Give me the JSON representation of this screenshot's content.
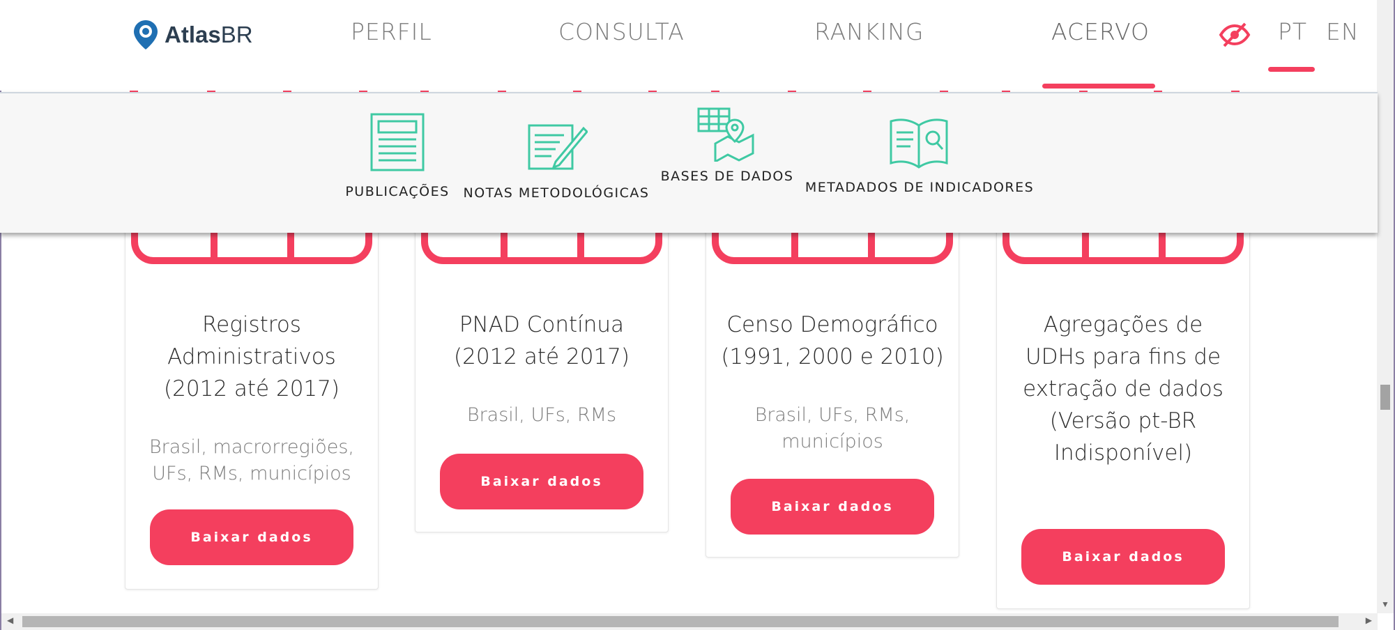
{
  "brand": {
    "name_bold": "Atlas",
    "name_regular": "BR"
  },
  "nav": {
    "links": [
      "PERFIL",
      "CONSULTA",
      "RANKING",
      "ACERVO"
    ],
    "active": "ACERVO",
    "languages": [
      "PT",
      "EN"
    ],
    "active_language": "PT"
  },
  "dropdown": {
    "items": [
      {
        "label": "PUBLICAÇÕES",
        "icon": "document-icon"
      },
      {
        "label": "NOTAS METODOLÓGICAS",
        "icon": "notes-pencil-icon"
      },
      {
        "label": "BASES DE DADOS",
        "icon": "grid-map-pin-icon"
      },
      {
        "label": "METADADOS DE INDICADORES",
        "icon": "open-book-search-icon"
      }
    ]
  },
  "cards": [
    {
      "title_lines": [
        "Registros",
        "Administrativos",
        "(2012 até 2017)"
      ],
      "sub_lines": [
        "Brasil, macrorregiões,",
        "UFs, RMs, municípios"
      ],
      "button": "Baixar dados"
    },
    {
      "title_lines": [
        "PNAD Contínua",
        "(2012 até 2017)"
      ],
      "sub_lines": [
        "Brasil, UFs, RMs"
      ],
      "button": "Baixar dados"
    },
    {
      "title_lines": [
        "Censo Demográfico",
        "(1991, 2000 e 2010)"
      ],
      "sub_lines": [
        "Brasil, UFs, RMs,",
        "municípios"
      ],
      "button": "Baixar dados"
    },
    {
      "title_lines": [
        "Agregações de",
        "UDHs para fins de",
        "extração de dados",
        "(Versão pt-BR",
        "Indisponível)"
      ],
      "sub_lines": [],
      "button": "Baixar dados"
    }
  ],
  "colors": {
    "accent": "#f43f5e",
    "teal": "#3fc9a3"
  }
}
